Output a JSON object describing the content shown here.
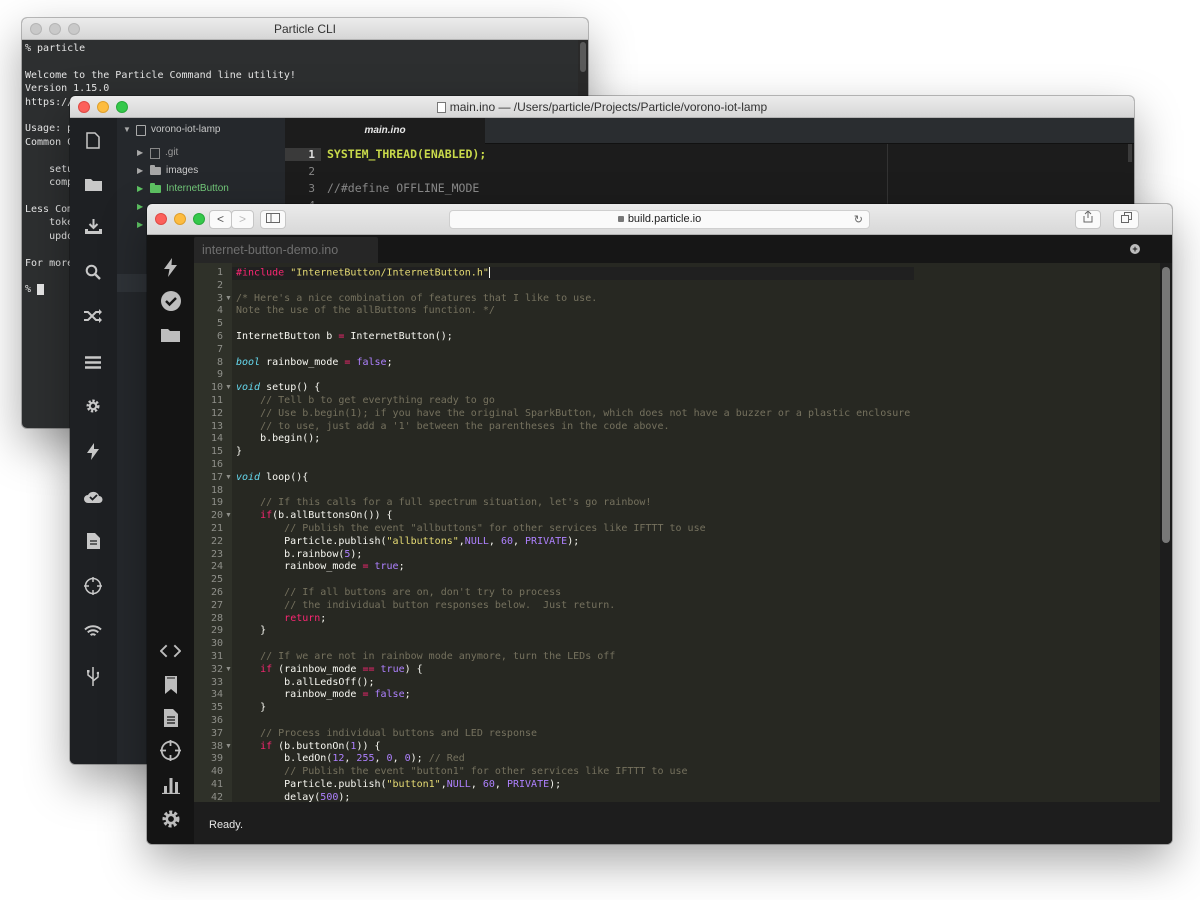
{
  "terminal": {
    "title": "Particle CLI",
    "lines": [
      "% particle",
      "",
      "Welcome to the Particle Command line utility!",
      "Version 1.15.0",
      "https://github.com/spark/particle-cli",
      "",
      "Usage: p",
      "Common C",
      "",
      "    setu",
      "    comp",
      "",
      "Less Com",
      "    toke",
      "    updo",
      "",
      "For more",
      "",
      "% "
    ]
  },
  "atom": {
    "title": "main.ino — /Users/particle/Projects/Particle/vorono-iot-lamp",
    "tab_label": "main.ino",
    "project_name": "vorono-iot-lamp",
    "tree_items": [
      ".git",
      "images",
      "InternetButton"
    ],
    "lines": [
      {
        "num": "1",
        "text": "SYSTEM_THREAD(ENABLED);"
      },
      {
        "num": "2",
        "text": ""
      },
      {
        "num": "3",
        "text": "//#define OFFLINE_MODE"
      },
      {
        "num": "4",
        "text": ""
      }
    ],
    "rail_icons": [
      "flash-icon",
      "cloud-check-icon",
      "file-icon",
      "target-icon",
      "wifi-icon",
      "usb-icon"
    ]
  },
  "browser": {
    "url": "build.particle.io",
    "back_label": "<",
    "forward_label": ">",
    "file_tab": "internet-button-demo.ino",
    "status_text": "Ready.",
    "code_lines": [
      "#include \"InternetButton/InternetButton.h\"",
      "",
      "/* Here's a nice combination of features that I like to use.",
      "Note the use of the allButtons function. */",
      "",
      "InternetButton b = InternetButton();",
      "",
      "bool rainbow_mode = false;",
      "",
      "void setup() {",
      "    // Tell b to get everything ready to go",
      "    // Use b.begin(1); if you have the original SparkButton, which does not have a buzzer or a plastic enclosure",
      "    // to use, just add a '1' between the parentheses in the code above.",
      "    b.begin();",
      "}",
      "",
      "void loop(){",
      "",
      "    // If this calls for a full spectrum situation, let's go rainbow!",
      "    if(b.allButtonsOn()) {",
      "        // Publish the event \"allbuttons\" for other services like IFTTT to use",
      "        Particle.publish(\"allbuttons\",NULL, 60, PRIVATE);",
      "        b.rainbow(5);",
      "        rainbow_mode = true;",
      "",
      "        // If all buttons are on, don't try to process",
      "        // the individual button responses below.  Just return.",
      "        return;",
      "    }",
      "",
      "    // If we are not in rainbow mode anymore, turn the LEDs off",
      "    if (rainbow_mode == true) {",
      "        b.allLedsOff();",
      "        rainbow_mode = false;",
      "    }",
      "",
      "    // Process individual buttons and LED response",
      "    if (b.buttonOn(1)) {",
      "        b.ledOn(12, 255, 0, 0); // Red",
      "        // Publish the event \"button1\" for other services like IFTTT to use",
      "        Particle.publish(\"button1\",NULL, 60, PRIVATE);",
      "        delay(500);"
    ],
    "fold_lines": [
      3,
      10,
      17,
      20,
      32,
      38
    ],
    "side_top_icons": [
      "flash-icon",
      "check-circle-icon",
      "folder-icon"
    ],
    "side_bottom_icons": [
      "code-icon",
      "bookmark-icon",
      "document-icon",
      "target-icon",
      "bar-chart-icon",
      "gear-icon"
    ]
  }
}
